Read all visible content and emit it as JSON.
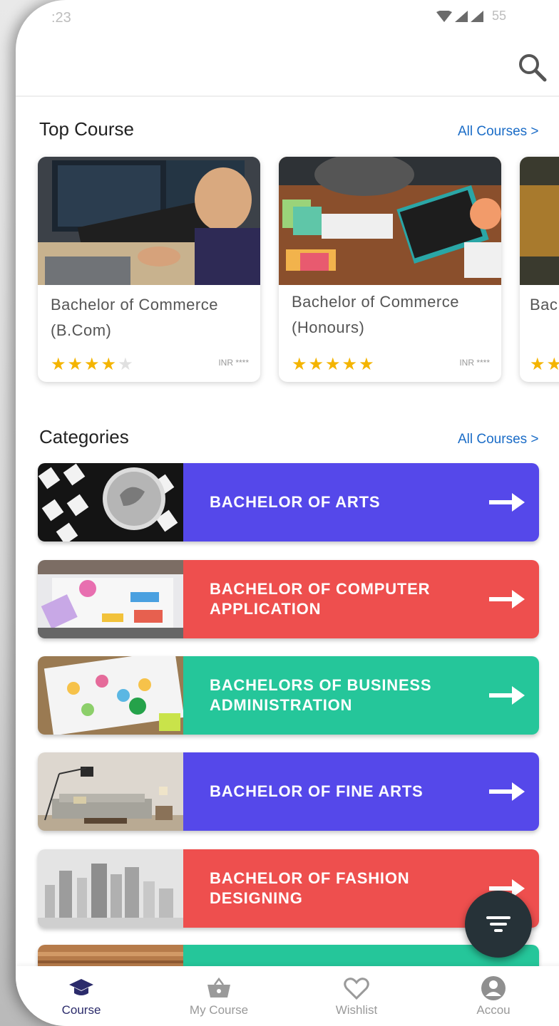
{
  "status_bar": {
    "time": ":23",
    "battery": "55"
  },
  "top_course": {
    "title": "Top Course",
    "see_all": "All Courses >",
    "cards": [
      {
        "title": "Bachelor of Commerce (B.Com)",
        "rating": 4,
        "max_rating": 5,
        "price": "INR ****"
      },
      {
        "title": "Bachelor of Commerce (Honours)",
        "rating": 5,
        "max_rating": 5,
        "price": "INR ****"
      },
      {
        "title": "Bac (Ho",
        "rating": 2,
        "max_rating": 5,
        "price": ""
      }
    ]
  },
  "categories": {
    "title": "Categories",
    "see_all": "All Courses >",
    "items": [
      {
        "label": "BACHELOR OF ARTS",
        "color": "#5548ea"
      },
      {
        "label": "BACHELOR OF COMPUTER APPLICATION",
        "color": "#ee4f4e"
      },
      {
        "label": "BACHELORS OF BUSINESS ADMINISTRATION",
        "color": "#25c69a"
      },
      {
        "label": "BACHELOR OF FINE ARTS",
        "color": "#5548ea"
      },
      {
        "label": "BACHELOR OF FASHION DESIGNING",
        "color": "#ee4f4e"
      },
      {
        "label": "",
        "color": "#25c69a"
      }
    ]
  },
  "bottom_nav": {
    "items": [
      {
        "label": "Course",
        "icon": "graduation-cap-icon",
        "active": true
      },
      {
        "label": "My Course",
        "icon": "basket-icon",
        "active": false
      },
      {
        "label": "Wishlist",
        "icon": "heart-icon",
        "active": false
      },
      {
        "label": "Accou",
        "icon": "account-icon",
        "active": false
      }
    ]
  },
  "colors": {
    "accent_link": "#1a6cc7",
    "star": "#f4b400",
    "fab": "#263238",
    "nav_active": "#2b2b6b"
  }
}
